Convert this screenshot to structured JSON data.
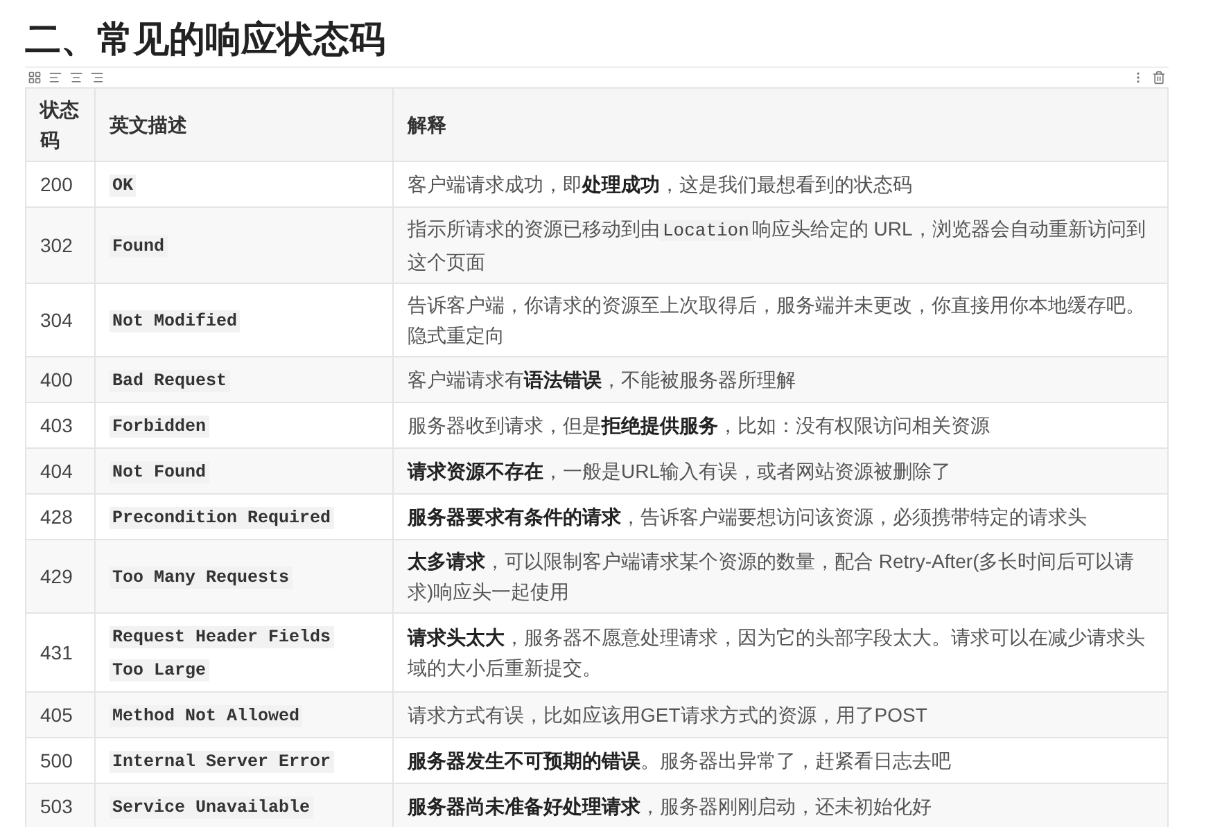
{
  "heading": "二、常见的响应状态码",
  "table": {
    "columns": [
      "状态码",
      "英文描述",
      "解释"
    ],
    "rows": [
      {
        "code": "200",
        "name": [
          "OK"
        ],
        "desc": [
          {
            "kind": "text",
            "text": "客户端请求成功，即**处理成功**，这是我们最想看到的状态码"
          }
        ]
      },
      {
        "code": "302",
        "name": [
          "Found"
        ],
        "desc": [
          {
            "kind": "text",
            "text": "指示所请求的资源已移动到由"
          },
          {
            "kind": "code",
            "text": "Location"
          },
          {
            "kind": "text",
            "text": "响应头给定的 URL，浏览器会自动重新访问到这个页面"
          }
        ]
      },
      {
        "code": "304",
        "name": [
          "Not Modified"
        ],
        "desc": [
          {
            "kind": "text",
            "text": "告诉客户端，你请求的资源至上次取得后，服务端并未更改，你直接用你本地缓存吧。隐式重定向"
          }
        ]
      },
      {
        "code": "400",
        "name": [
          "Bad Request"
        ],
        "desc": [
          {
            "kind": "text",
            "text": "客户端请求有**语法错误**，不能被服务器所理解"
          }
        ]
      },
      {
        "code": "403",
        "name": [
          "Forbidden"
        ],
        "desc": [
          {
            "kind": "text",
            "text": "服务器收到请求，但是**拒绝提供服务**，比如：没有权限访问相关资源"
          }
        ]
      },
      {
        "code": "404",
        "name": [
          "Not Found"
        ],
        "desc": [
          {
            "kind": "text",
            "text": "**请求资源不存在**，一般是URL输入有误，或者网站资源被删除了"
          }
        ]
      },
      {
        "code": "428",
        "name": [
          "Precondition Required"
        ],
        "desc": [
          {
            "kind": "text",
            "text": "**服务器要求有条件的请求**，告诉客户端要想访问该资源，必须携带特定的请求头"
          }
        ]
      },
      {
        "code": "429",
        "name": [
          "Too Many Requests"
        ],
        "desc": [
          {
            "kind": "text",
            "text": "**太多请求**，可以限制客户端请求某个资源的数量，配合 Retry-After(多长时间后可以请求)响应头一起使用"
          }
        ]
      },
      {
        "code": "431",
        "name": [
          "Request Header Fields",
          "Too Large"
        ],
        "desc": [
          {
            "kind": "text",
            "text": "**请求头太大**，服务器不愿意处理请求，因为它的头部字段太大。请求可以在减少请求头域的大小后重新提交。"
          }
        ]
      },
      {
        "code": "405",
        "name": [
          "Method Not Allowed"
        ],
        "desc": [
          {
            "kind": "text",
            "text": "请求方式有误，比如应该用GET请求方式的资源，用了POST"
          }
        ]
      },
      {
        "code": "500",
        "name": [
          "Internal Server Error"
        ],
        "desc": [
          {
            "kind": "text",
            "text": "**服务器发生不可预期的错误**。服务器出异常了，赶紧看日志去吧"
          }
        ]
      },
      {
        "code": "503",
        "name": [
          "Service Unavailable"
        ],
        "desc": [
          {
            "kind": "text",
            "text": "**服务器尚未准备好处理请求**，服务器刚刚启动，还未初始化好"
          }
        ]
      }
    ]
  }
}
